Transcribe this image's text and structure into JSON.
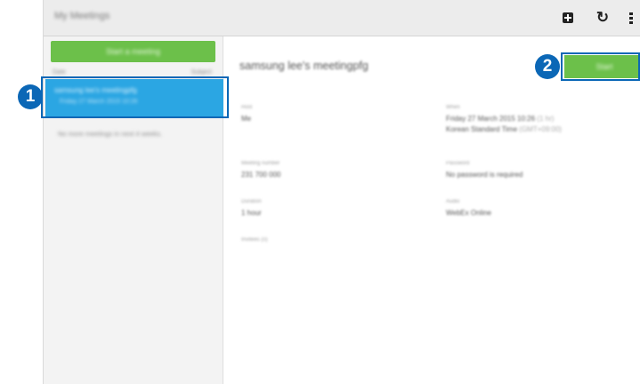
{
  "app": {
    "title": "My Meetings",
    "icons": {
      "add": "add-icon",
      "refresh": "refresh-icon",
      "menu": "more-options-icon"
    }
  },
  "sidebar": {
    "start_button": "Start a meeting",
    "list_header_left": "Date",
    "list_header_right": "Subject",
    "selected_item": {
      "title": "samsung lee's meetingpfg",
      "subtitle": "Friday 27 March 2015 10:26"
    },
    "empty_text": "No more meetings in next 4 weeks."
  },
  "detail": {
    "title": "samsung lee's meetingpfg",
    "start_button": "Start",
    "fields": [
      {
        "label": "Host",
        "value": "Me"
      },
      {
        "label": "Meeting number",
        "value": "231 700 000"
      },
      {
        "label": "Duration",
        "value": "1 hour"
      },
      {
        "label": "Invitees (0)",
        "value": ""
      }
    ],
    "when": {
      "label": "When",
      "line1": "Friday 27 March 2015 10:26",
      "line1_extra": "(1 hr)",
      "line2": "Korean Standard Time",
      "line2_extra": "(GMT+09:00)"
    },
    "password": {
      "label": "Password",
      "value": "No password is required"
    },
    "audio": {
      "label": "Audio",
      "value": "WebEx Online"
    }
  },
  "callouts": [
    {
      "number": "1"
    },
    {
      "number": "2"
    }
  ],
  "colors": {
    "accent_green": "#6cc04a",
    "selection_blue": "#2ba6e3",
    "callout_blue": "#0b67b6"
  }
}
